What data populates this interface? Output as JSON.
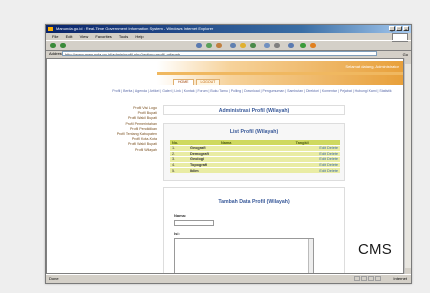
{
  "window": {
    "title": "Manunda.go.id : Real-Time Government Information System - Windows Internet Explorer",
    "controls": [
      "_",
      "□",
      "×"
    ]
  },
  "menu": [
    "File",
    "Edit",
    "View",
    "Favorites",
    "Tools",
    "Help"
  ],
  "address": {
    "label": "Address",
    "url": "http://www.manunda.go.id/admin/profil.php?action=profil_wilayah",
    "go": "Go"
  },
  "status": {
    "left": "Done",
    "right": "Internet"
  },
  "site": {
    "header_text": "Selamat datang, Administrator",
    "tabs": [
      "HOME",
      "LOGOUT"
    ],
    "main_links": "Profil | Berita | Agenda | Artikel | Galeri | Link | Kontak | Forum | Buku Tamu | Polling | Download | Pengumuman | Sambutan | Direktori | Komentar | Pejabat | Hubungi Kami | Statistik"
  },
  "sidemenu": [
    "Profil Visi Logo",
    "Profil Bupati",
    "Profil Wakil Bupati",
    "Profil Pemerintahan",
    "Profil Pendidikan",
    "Profil Tentang Kabupaten",
    "Profil Kota-Kota",
    "Profil Wakil Bupati",
    "Profil Wilayah"
  ],
  "admin_panel": {
    "title": "Administrasi Profil (Wilayah)"
  },
  "list_panel": {
    "title": "List Profil (Wilayah)",
    "columns": [
      "No.",
      "Nama",
      "Tangkil"
    ],
    "rows": [
      {
        "no": "1.",
        "name": "Geografi",
        "action": "Edit Delete"
      },
      {
        "no": "2.",
        "name": "Demografi",
        "action": "Edit Delete"
      },
      {
        "no": "3.",
        "name": "Geologi",
        "action": "Edit Delete"
      },
      {
        "no": "4.",
        "name": "Topografi",
        "action": "Edit Delete"
      },
      {
        "no": "5.",
        "name": "Iklim",
        "action": "Edit Delete"
      }
    ]
  },
  "form_panel": {
    "title": "Tambah Data Profil (Wilayah)",
    "name_label": "Nama:",
    "content_label": "Isi:"
  },
  "watermark": "CMS"
}
